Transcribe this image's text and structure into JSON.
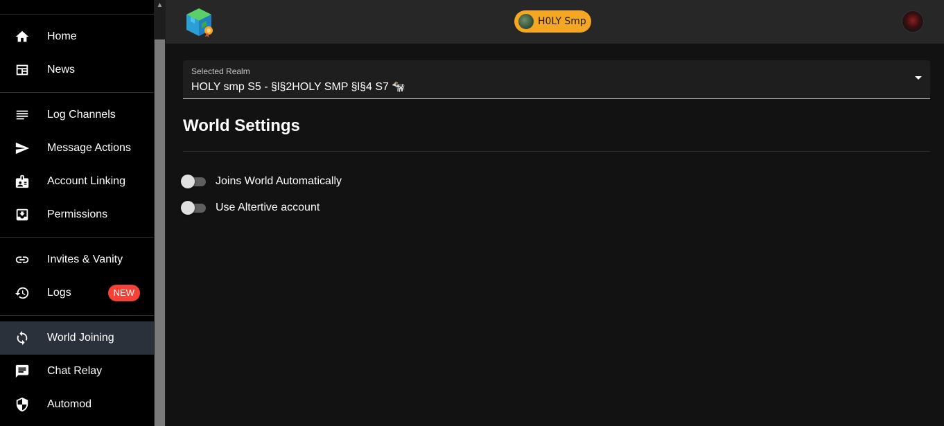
{
  "sidebar": {
    "groups": [
      [
        {
          "label": "Home",
          "icon": "home-icon"
        },
        {
          "label": "News",
          "icon": "newspaper-icon"
        }
      ],
      [
        {
          "label": "Log Channels",
          "icon": "lines-icon"
        },
        {
          "label": "Message Actions",
          "icon": "send-icon"
        },
        {
          "label": "Account Linking",
          "icon": "id-badge-icon"
        },
        {
          "label": "Permissions",
          "icon": "inbox-down-icon"
        }
      ],
      [
        {
          "label": "Invites & Vanity",
          "icon": "link-icon"
        },
        {
          "label": "Logs",
          "icon": "history-icon",
          "badge": "NEW"
        }
      ],
      [
        {
          "label": "World Joining",
          "icon": "sync-icon",
          "active": true
        },
        {
          "label": "Chat Relay",
          "icon": "chat-icon"
        },
        {
          "label": "Automod",
          "icon": "shield-icon"
        }
      ]
    ]
  },
  "topbar": {
    "realm_chip_label": "H0LY Smp"
  },
  "main": {
    "realm_select_label": "Selected Realm",
    "realm_select_value": "HOLY smp S5 - §l§2HOLY SMP §l§4 S7 🐄",
    "section_title": "World Settings",
    "settings": [
      {
        "label": "Joins World Automatically",
        "enabled": false
      },
      {
        "label": "Use Altertive account",
        "enabled": false
      }
    ]
  },
  "colors": {
    "accent_chip": "#f5a623",
    "active_nav": "#2b313a",
    "badge": "#f44336"
  }
}
